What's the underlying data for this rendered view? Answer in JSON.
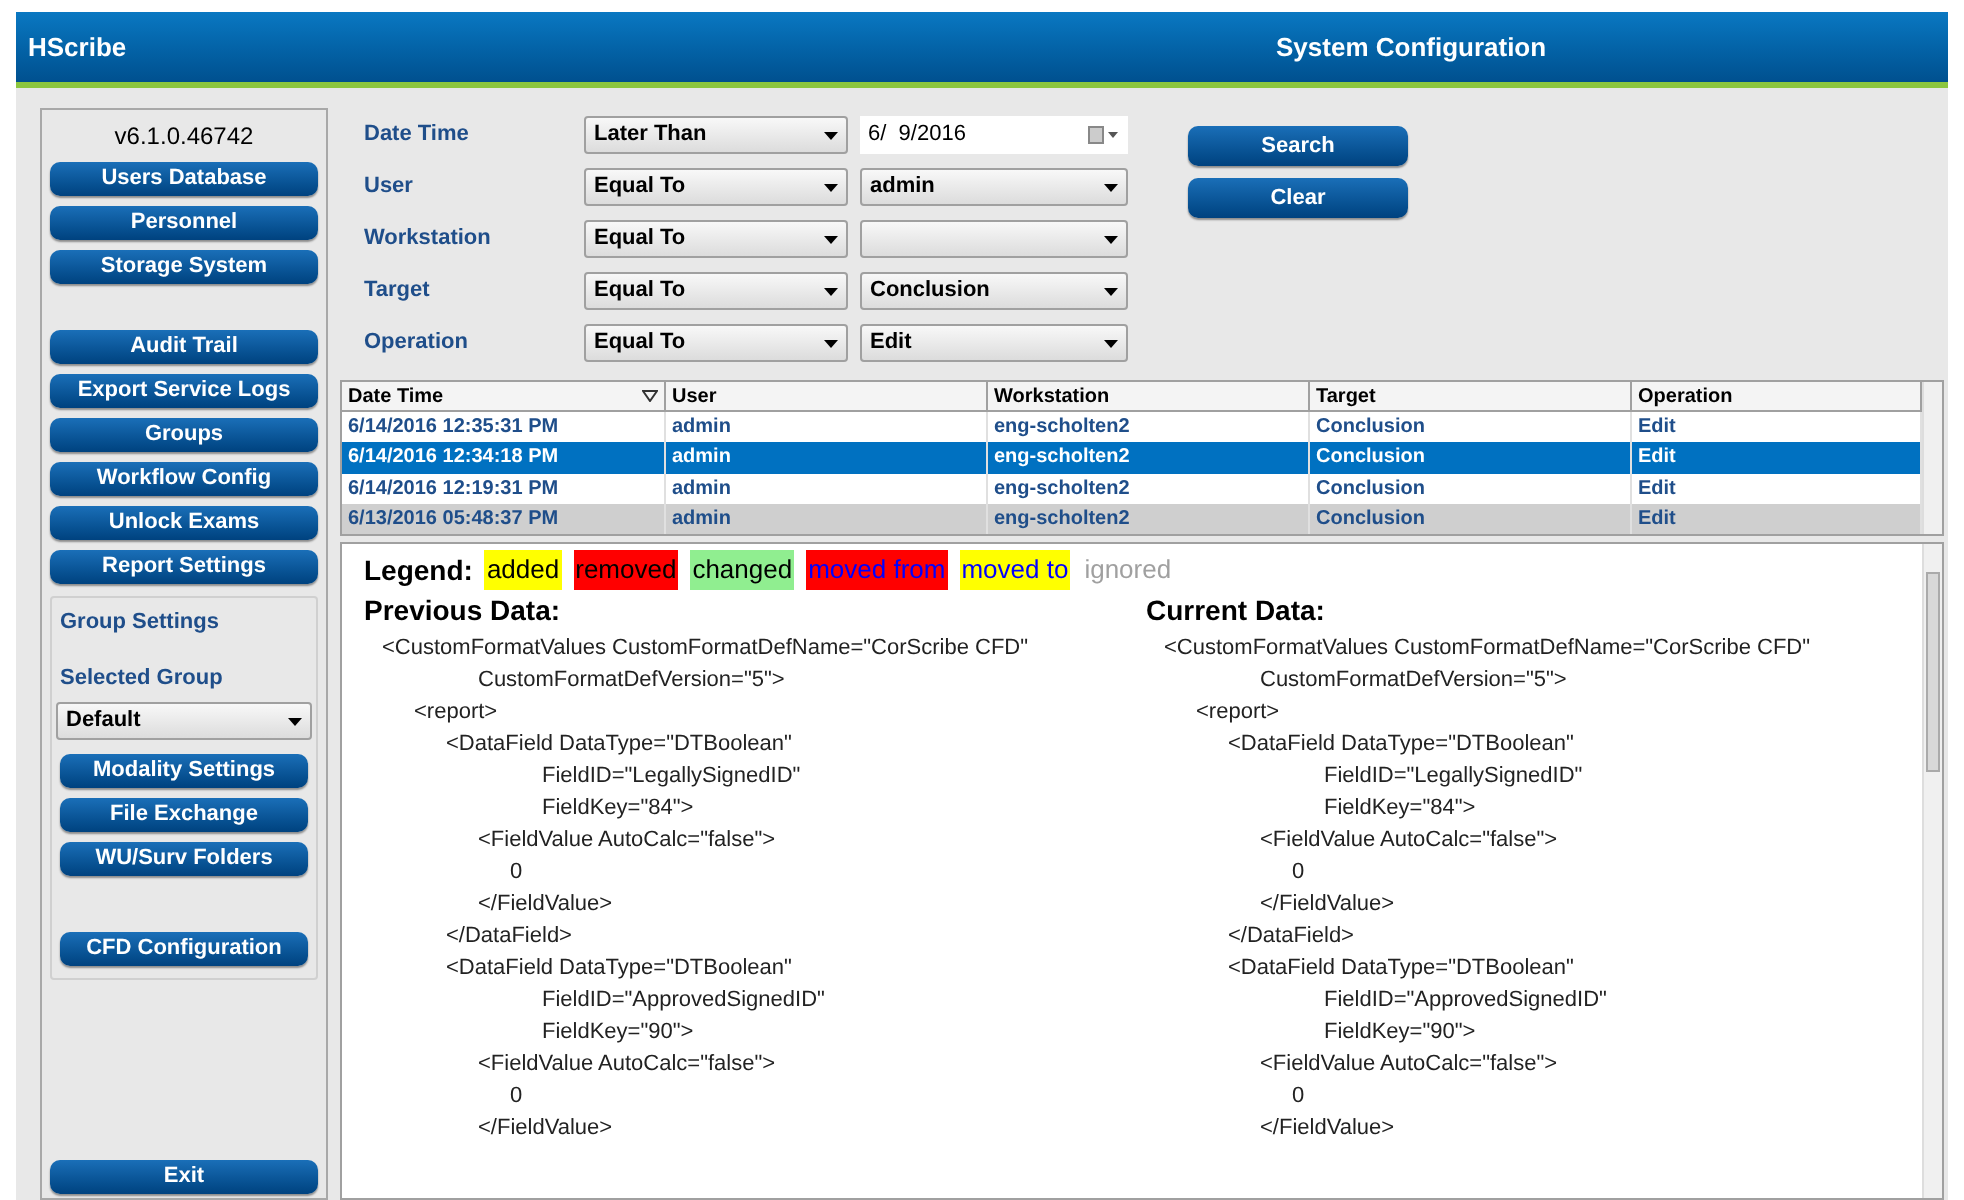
{
  "window": {
    "app_name": "HScribe",
    "title": "System Configuration"
  },
  "sidebar": {
    "version": "v6.1.0.46742",
    "top_buttons": [
      "Users Database",
      "Personnel",
      "Storage System"
    ],
    "middle_buttons": [
      "Audit Trail",
      "Export Service Logs",
      "Groups",
      "Workflow Config",
      "Unlock Exams",
      "Report Settings"
    ],
    "group_settings": {
      "title": "Group Settings",
      "selected_group_label": "Selected Group",
      "selected_group": "Default",
      "buttons": [
        "Modality Settings",
        "File Exchange",
        "WU/Surv Folders"
      ],
      "bottom_button": "CFD Configuration"
    },
    "exit_button": "Exit"
  },
  "filters": [
    {
      "label": "Date Time",
      "operator": "Later Than",
      "kind": "date",
      "value": "6/  9/2016"
    },
    {
      "label": "User",
      "operator": "Equal To",
      "kind": "dropdown",
      "value": "admin"
    },
    {
      "label": "Workstation",
      "operator": "Equal To",
      "kind": "dropdown"
    },
    {
      "label": "Target",
      "operator": "Equal To",
      "kind": "dropdown",
      "value": "Conclusion"
    },
    {
      "label": "Operation",
      "operator": "Equal To",
      "kind": "dropdown",
      "value": "Edit"
    }
  ],
  "buttons": [
    "Search",
    "Clear"
  ],
  "table": {
    "columns": [
      {
        "label": "Date Time",
        "sorted": true
      },
      {
        "label": "User",
        "sorted": false
      },
      {
        "label": "Workstation",
        "sorted": false
      },
      {
        "label": "Target",
        "sorted": false
      },
      {
        "label": "Operation",
        "sorted": false
      }
    ],
    "rows": [
      {
        "cells": [
          "6/14/2016 12:35:31 PM",
          "admin",
          "eng-scholten2",
          "Conclusion",
          "Edit"
        ],
        "selected": false,
        "hovered": false
      },
      {
        "cells": [
          "6/14/2016 12:34:18 PM",
          "admin",
          "eng-scholten2",
          "Conclusion",
          "Edit"
        ],
        "selected": true,
        "hovered": false
      },
      {
        "cells": [
          "6/14/2016 12:19:31 PM",
          "admin",
          "eng-scholten2",
          "Conclusion",
          "Edit"
        ],
        "selected": false,
        "hovered": false
      },
      {
        "cells": [
          "6/13/2016 05:48:37 PM",
          "admin",
          "eng-scholten2",
          "Conclusion",
          "Edit"
        ],
        "selected": false,
        "hovered": true
      }
    ]
  },
  "legend": {
    "title": "Legend:",
    "items": [
      {
        "label": "added",
        "color": "#ffff00",
        "kind": "plain"
      },
      {
        "label": "removed",
        "color": "#ff0000",
        "kind": "plain"
      },
      {
        "label": "changed",
        "color": "#90ee90",
        "kind": "plain"
      },
      {
        "label": "moved from",
        "color": "#ff0000",
        "kind": "moved"
      },
      {
        "label": "moved to",
        "color": "#ffff00",
        "kind": "moved"
      },
      {
        "label": "ignored",
        "kind": "ignored"
      }
    ]
  },
  "panes": [
    {
      "title": "Previous Data:",
      "tree": [
        {
          "lines": [
            "<CustomFormatValues CustomFormatDefName=\"CorScribe CFD\"",
            "CustomFormatDefVersion=\"5\">"
          ],
          "children": [
            {
              "lines": [
                "<report>"
              ],
              "children": [
                {
                  "lines": [
                    "<DataField DataType=\"DTBoolean\"",
                    "FieldID=\"LegallySignedID\"",
                    "FieldKey=\"84\">"
                  ],
                  "children": [
                    {
                      "lines": [
                        "<FieldValue AutoCalc=\"false\">"
                      ],
                      "children": [
                        {
                          "lines": [
                            "0"
                          ]
                        }
                      ]
                    },
                    {
                      "lines": [
                        "</FieldValue>"
                      ]
                    }
                  ]
                },
                {
                  "lines": [
                    "</DataField>"
                  ]
                },
                {
                  "lines": [
                    "<DataField DataType=\"DTBoolean\"",
                    "FieldID=\"ApprovedSignedID\"",
                    "FieldKey=\"90\">"
                  ],
                  "children": [
                    {
                      "lines": [
                        "<FieldValue AutoCalc=\"false\">"
                      ],
                      "children": [
                        {
                          "lines": [
                            "0"
                          ]
                        }
                      ]
                    },
                    {
                      "lines": [
                        "</FieldValue>"
                      ]
                    }
                  ]
                }
              ]
            }
          ]
        }
      ]
    },
    {
      "title": "Current Data:",
      "tree": [
        {
          "lines": [
            "<CustomFormatValues CustomFormatDefName=\"CorScribe CFD\"",
            "CustomFormatDefVersion=\"5\">"
          ],
          "children": [
            {
              "lines": [
                "<report>"
              ],
              "children": [
                {
                  "lines": [
                    "<DataField DataType=\"DTBoolean\"",
                    "FieldID=\"LegallySignedID\"",
                    "FieldKey=\"84\">"
                  ],
                  "children": [
                    {
                      "lines": [
                        "<FieldValue AutoCalc=\"false\">"
                      ],
                      "children": [
                        {
                          "lines": [
                            "0"
                          ]
                        }
                      ]
                    },
                    {
                      "lines": [
                        "</FieldValue>"
                      ]
                    }
                  ]
                },
                {
                  "lines": [
                    "</DataField>"
                  ]
                },
                {
                  "lines": [
                    "<DataField DataType=\"DTBoolean\"",
                    "FieldID=\"ApprovedSignedID\"",
                    "FieldKey=\"90\">"
                  ],
                  "children": [
                    {
                      "lines": [
                        "<FieldValue AutoCalc=\"false\">"
                      ],
                      "children": [
                        {
                          "lines": [
                            "0"
                          ]
                        }
                      ]
                    },
                    {
                      "lines": [
                        "</FieldValue>"
                      ]
                    }
                  ]
                }
              ]
            }
          ]
        }
      ]
    }
  ]
}
